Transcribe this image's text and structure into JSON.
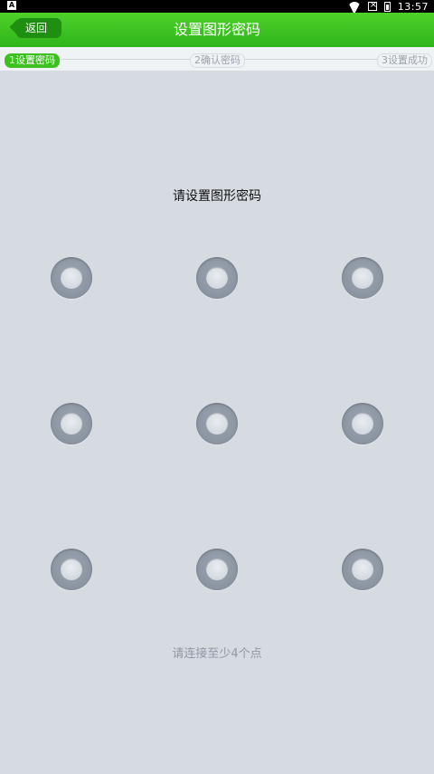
{
  "status_bar": {
    "left_icon": "A",
    "time": "13:57",
    "icons": [
      "wifi-icon",
      "no-signal-icon",
      "battery-icon"
    ]
  },
  "header": {
    "back_label": "返回",
    "title": "设置图形密码"
  },
  "steps": [
    {
      "label": "1设置密码",
      "active": true
    },
    {
      "label": "2确认密码",
      "active": false
    },
    {
      "label": "3设置成功",
      "active": false
    }
  ],
  "pattern": {
    "prompt": "请设置图形密码",
    "hint": "请连接至少4个点",
    "points": [
      1,
      2,
      3,
      4,
      5,
      6,
      7,
      8,
      9
    ]
  },
  "colors": {
    "accent": "#3cc21f",
    "header_start": "#4fd12a",
    "header_end": "#2fb51a"
  }
}
